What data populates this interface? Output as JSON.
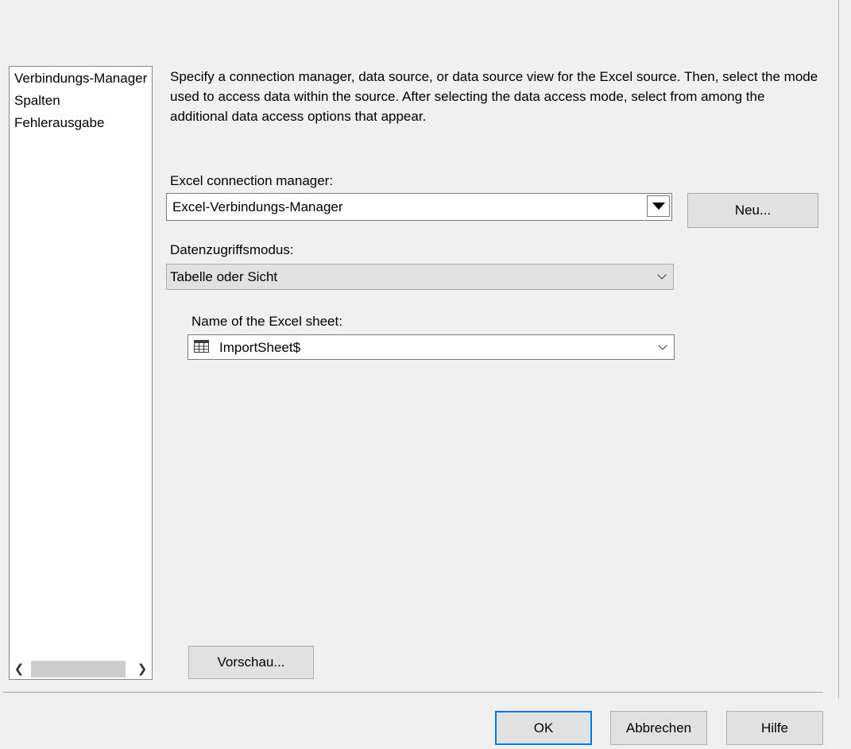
{
  "nav": {
    "items": [
      {
        "label": "Verbindungs-Manager"
      },
      {
        "label": "Spalten"
      },
      {
        "label": "Fehlerausgabe"
      }
    ]
  },
  "description": "Specify a connection manager, data source, or data source view for the Excel source. Then, select the mode used to access data within the source. After selecting the data access mode, select from among the additional data access options that appear.",
  "connection": {
    "label": "Excel connection manager:",
    "value": "Excel-Verbindungs-Manager",
    "new_button": "Neu..."
  },
  "access_mode": {
    "label": "Datenzugriffsmodus:",
    "value": "Tabelle oder Sicht"
  },
  "sheet": {
    "label": "Name of the Excel sheet:",
    "value": "ImportSheet$",
    "icon": "table-icon"
  },
  "preview_button": "Vorschau...",
  "footer": {
    "ok": "OK",
    "cancel": "Abbrechen",
    "help": "Hilfe"
  },
  "colors": {
    "focus_border": "#0078d7",
    "background": "#f0f0f0"
  }
}
